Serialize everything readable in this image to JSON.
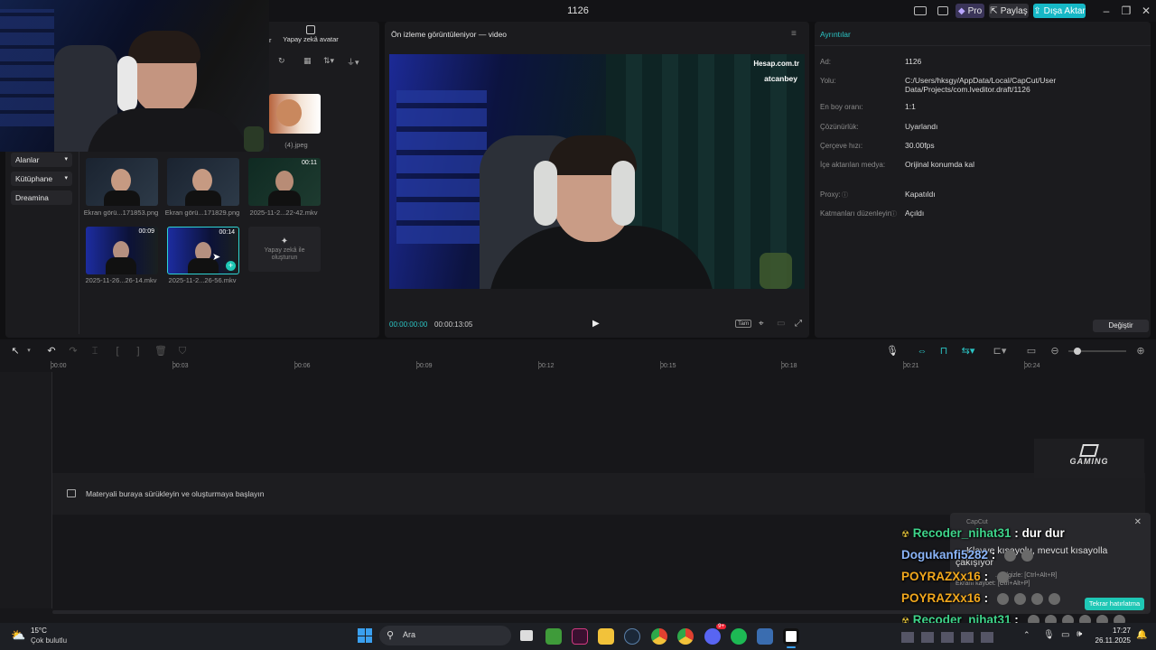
{
  "titlebar": {
    "title": "1126",
    "pro_label": "Pro",
    "share_label": "Paylaş",
    "export_label": "Dışa Aktar"
  },
  "media_panel": {
    "tab_ai_avatar": "Yapay zekâ avatar",
    "tab_partial": "r",
    "nav": [
      "Alanlar",
      "Kütüphane",
      "Dreamina"
    ],
    "items": [
      {
        "label": "(4).jpeg",
        "duration": ""
      },
      {
        "label": "Ekran görü...171853.png",
        "duration": ""
      },
      {
        "label": "Ekran görü...171829.png",
        "duration": ""
      },
      {
        "label": "2025-11-2...22-42.mkv",
        "duration": "00:11"
      },
      {
        "label": "2025-11-26...26-14.mkv",
        "duration": "00:09"
      },
      {
        "label": "2025-11-2...26-56.mkv",
        "duration": "00:14"
      }
    ],
    "ai_create_label": "Yapay zekâ ile oluşturun"
  },
  "preview": {
    "title": "Ön izleme görüntüleniyor — video",
    "current_time": "00:00:00:00",
    "total_time": "00:00:13:05",
    "watermark_site": "Hesap.com.tr",
    "watermark_user": "atcanbey",
    "full_label": "Tam"
  },
  "details": {
    "title": "Ayrıntılar",
    "rows": [
      {
        "label": "Ad:",
        "value": "1126"
      },
      {
        "label": "Yolu:",
        "value": "C:/Users/hksgy/AppData/Local/CapCut/User Data/Projects/com.lveditor.draft/1126"
      },
      {
        "label": "En boy oranı:",
        "value": "1:1"
      },
      {
        "label": "Çözünürlük:",
        "value": "Uyarlandı"
      },
      {
        "label": "Çerçeve hızı:",
        "value": "30.00fps"
      },
      {
        "label": "İçe aktarılan medya:",
        "value": "Orijinal konumda kal"
      },
      {
        "label": "Proxy:",
        "value": "Kapatıldı"
      },
      {
        "label": "Katmanları düzenleyin",
        "value": "Açıldı"
      }
    ],
    "modify_label": "Değiştir"
  },
  "timeline": {
    "ticks": [
      "00:00",
      "00:03",
      "00:06",
      "00:09",
      "00:12",
      "00:15",
      "00:18",
      "00:21",
      "00:24"
    ],
    "drop_hint": "Materyali buraya sürükleyin ve oluşturmaya başlayın"
  },
  "overlay": {
    "gaming_logo": "GAMING",
    "capcut_popup_app": "CapCut",
    "popup_line1": "Klavye kısayolu, mevcut kısayolla",
    "popup_line2": "çakışıyor",
    "popup_line3": "...er/gizle: [Ctrl+Alt+R]",
    "popup_line4": "Ekranı kaybet: [Ctrl+Alt+P]",
    "popup_button": "Tekrar hatırlatma"
  },
  "chat": [
    {
      "user": "Recoder_nihat31",
      "message": "dur dur",
      "color": "#3ed48a"
    },
    {
      "user": "Dogukanfi5282",
      "message": "",
      "color": "#8ab4f8"
    },
    {
      "user": "POYRAZXx16",
      "message": "",
      "color": "#f2a81d"
    },
    {
      "user": "POYRAZXx16",
      "message": "",
      "color": "#f2a81d"
    },
    {
      "user": "Recoder_nihat31",
      "message": "",
      "color": "#3ed48a"
    }
  ],
  "taskbar": {
    "temp": "15°C",
    "weather": "Çok bulutlu",
    "search_placeholder": "Ara",
    "time": "17:27",
    "date": "26.11.2025",
    "badge": "9+"
  }
}
